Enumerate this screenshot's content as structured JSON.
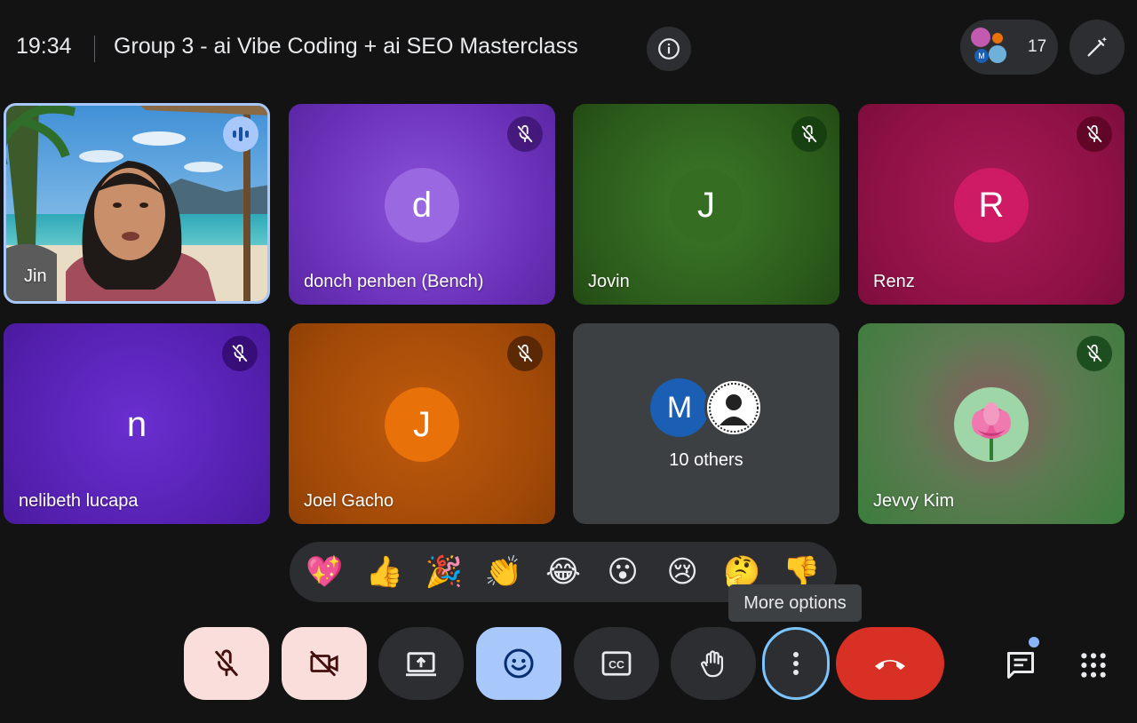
{
  "header": {
    "time": "19:34",
    "title": "Group 3 - ai Vibe Coding + ai SEO Masterclass",
    "participant_count": "17"
  },
  "tiles": [
    {
      "name": "Jin",
      "type": "video",
      "speaking": true
    },
    {
      "name": "donch penben (Bench)",
      "initial": "d",
      "muted": true,
      "color": "#7b3fc9"
    },
    {
      "name": "Jovin",
      "initial": "J",
      "muted": true,
      "color": "#2f6b1b"
    },
    {
      "name": "Renz",
      "initial": "R",
      "muted": true,
      "color": "#b0124d"
    },
    {
      "name": "nelibeth lucapa",
      "initial": "n",
      "muted": true,
      "color": "#5820b8"
    },
    {
      "name": "Joel Gacho",
      "initial": "J",
      "muted": true,
      "color": "#c2570c"
    },
    {
      "name": "10 others",
      "initial": "M",
      "type": "others"
    },
    {
      "name": "Jevvy Kim",
      "muted": true,
      "color": "#3b7d3c",
      "avatar_icon": "lotus-icon"
    }
  ],
  "reactions": [
    "💖",
    "👍",
    "🎉",
    "👏",
    "😂",
    "😮",
    "😢",
    "🤔",
    "👎"
  ],
  "tooltip": "More options",
  "controls": [
    {
      "name": "mic-off-button",
      "icon": "mic-off-icon"
    },
    {
      "name": "camera-off-button",
      "icon": "camera-off-icon"
    },
    {
      "name": "present-button",
      "icon": "present-icon"
    },
    {
      "name": "reactions-button",
      "icon": "emoji-icon",
      "active": true
    },
    {
      "name": "captions-button",
      "icon": "cc-icon"
    },
    {
      "name": "raise-hand-button",
      "icon": "hand-icon"
    },
    {
      "name": "more-options-button",
      "icon": "more-vert-icon",
      "focused": true
    },
    {
      "name": "leave-call-button",
      "icon": "phone-hangup-icon"
    }
  ],
  "colors": {
    "background": "#131313",
    "control": "#2d2e31",
    "danger": "#d93025",
    "muted_ctrl": "#f9dedc",
    "active_ctrl": "#a8c7fa",
    "focus_ring": "#7cc4ff"
  }
}
